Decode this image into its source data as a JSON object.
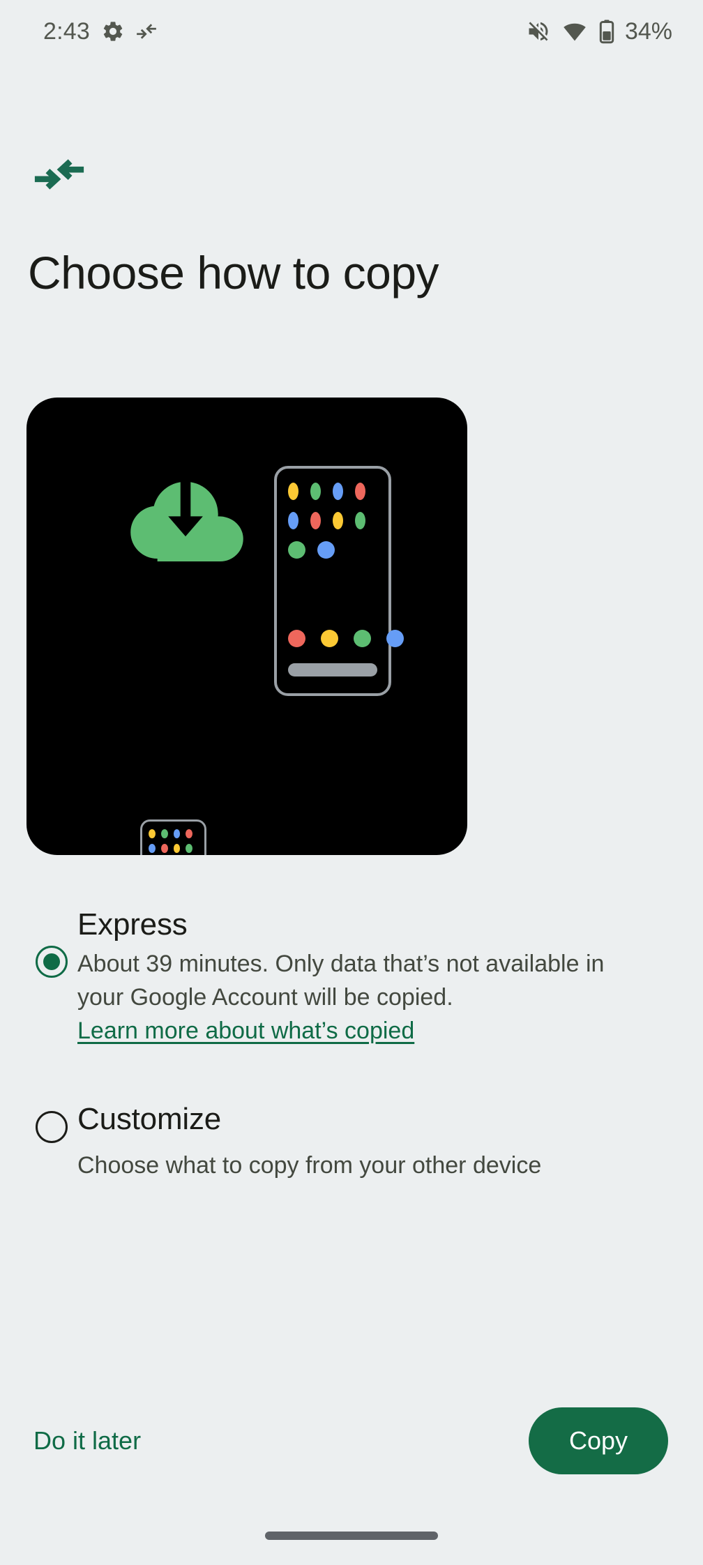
{
  "status_bar": {
    "time": "2:43",
    "battery_percent": "34%",
    "icons": {
      "settings": "gear-icon",
      "transfer": "transfer-arrows-icon",
      "mute": "volume-mute-icon",
      "wifi": "wifi-icon",
      "battery": "battery-icon"
    }
  },
  "nav": {
    "icon": "transfer-arrows-icon",
    "icon_color": "#1b6b52"
  },
  "header": {
    "title": "Choose how to copy"
  },
  "illustration": {
    "background": "#000000",
    "cloud_color": "#5dbd72",
    "arrow_color": "#000000",
    "phone_outline": "#9aa0a6",
    "home_bar_color": "#9aa0a6",
    "dot_colors": {
      "yellow": "#fcc934",
      "green": "#5dbd72",
      "blue": "#669df6",
      "red": "#ee675c"
    },
    "small_phone": {
      "grid": [
        [
          "yellow",
          "green",
          "blue",
          "red"
        ],
        [
          "blue",
          "red",
          "yellow",
          "green"
        ],
        [
          "green",
          "blue"
        ]
      ],
      "dock": [
        "red",
        "yellow",
        "green",
        "blue"
      ]
    },
    "large_phone": {
      "grid": [
        [
          "yellow",
          "green",
          "blue",
          "red"
        ],
        [
          "blue",
          "red",
          "yellow",
          "green"
        ],
        [
          "green",
          "blue"
        ]
      ],
      "dock": [
        "red",
        "yellow",
        "green",
        "blue"
      ]
    }
  },
  "options": [
    {
      "id": "express",
      "title": "Express",
      "description": "About 39 minutes. Only data that’s not available in your Google Account will be copied.",
      "link": "Learn more about what’s copied",
      "selected": true
    },
    {
      "id": "customize",
      "title": "Customize",
      "description": "Choose what to copy from your other device",
      "selected": false
    }
  ],
  "footer": {
    "secondary_label": "Do it later",
    "primary_label": "Copy",
    "primary_bg": "#146c46",
    "link_color": "#0f6b46"
  },
  "theme": {
    "background": "#eceff0",
    "text_primary": "#1b1c18",
    "text_secondary": "#43483f",
    "accent": "#0f6b46"
  }
}
